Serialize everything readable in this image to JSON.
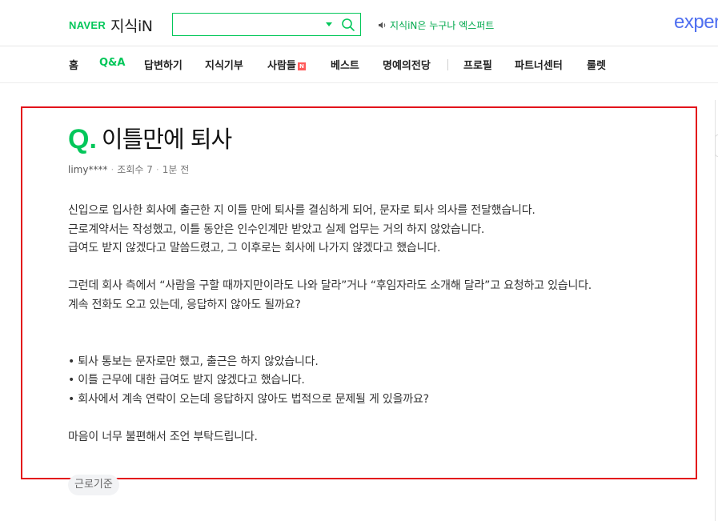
{
  "header": {
    "logo_naver": "NAVER",
    "logo_kin": "지식iN",
    "search": {
      "value": "",
      "placeholder": ""
    },
    "promo_text": "지식iN은 누구나 엑스퍼트",
    "expert_logo": "expert",
    "brand_color": "#03c75a"
  },
  "nav": {
    "items": [
      {
        "label": "홈"
      },
      {
        "label": "Q&A"
      },
      {
        "label": "답변하기"
      },
      {
        "label": "지식기부"
      },
      {
        "label": "사람들"
      },
      {
        "label": "베스트"
      },
      {
        "label": "명예의전당"
      },
      {
        "label": "프로필"
      },
      {
        "label": "파트너센터"
      },
      {
        "label": "룰렛"
      }
    ],
    "new_badge": "N",
    "active": "Q&A"
  },
  "question": {
    "q_mark": "Q",
    "title": "이틀만에 퇴사",
    "author": "limy****",
    "views": "조회수 7",
    "time": "1분 전",
    "paragraphs": [
      [
        "신입으로 입사한 회사에 출근한 지 이틀 만에 퇴사를 결심하게 되어, 문자로 퇴사 의사를 전달했습니다.",
        "근로계약서는 작성했고, 이틀 동안은 인수인계만 받았고 실제 업무는 거의 하지 않았습니다.",
        "급여도 받지 않겠다고 말씀드렸고, 그 이후로는 회사에 나가지 않겠다고 했습니다."
      ],
      [
        "그런데 회사 측에서 “사람을 구할 때까지만이라도 나와 달라”거나 “후임자라도 소개해 달라”고 요청하고 있습니다.",
        "계속 전화도 오고 있는데, 응답하지 않아도 될까요?"
      ],
      [
        "• 퇴사 통보는 문자로만 했고, 출근은 하지 않았습니다.",
        "• 이틀 근무에 대한 급여도 받지 않겠다고 했습니다.",
        "• 회사에서 계속 연락이 오는데 응답하지 않아도 법적으로 문제될 게 있을까요?"
      ],
      [
        "마음이 너무 불편해서 조언 부탁드립니다."
      ]
    ],
    "tag": "근로기준"
  },
  "colors": {
    "highlight": "#e3131b",
    "accent": "#03c75a",
    "expert": "#4f6ff0"
  }
}
